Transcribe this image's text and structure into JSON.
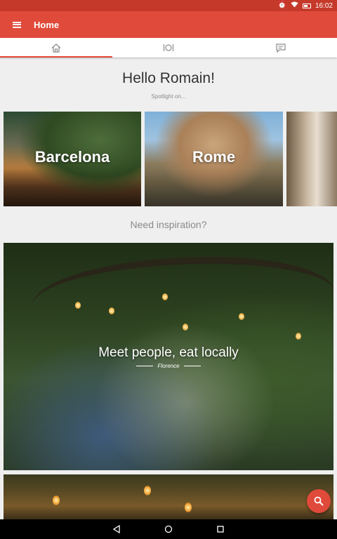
{
  "status_bar": {
    "time": "16:02",
    "icons": [
      "clock-icon",
      "wifi-icon",
      "battery-icon"
    ]
  },
  "app_bar": {
    "title": "Home",
    "background": "#e04a3b"
  },
  "tabs": [
    {
      "name": "home",
      "icon": "home-icon",
      "active": true
    },
    {
      "name": "dining",
      "icon": "plate-cutlery-icon",
      "active": false
    },
    {
      "name": "messages",
      "icon": "message-icon",
      "active": false
    }
  ],
  "greeting": "Hello Romain!",
  "spotlight_label": "Spotlight on...",
  "cities": [
    {
      "label": "Barcelona"
    },
    {
      "label": "Rome"
    },
    {
      "label": ""
    }
  ],
  "inspiration_label": "Need inspiration?",
  "hero": {
    "title": "Meet people, eat locally",
    "subtitle": "Florence"
  },
  "fab": {
    "icon": "search-icon"
  },
  "nav_bar": {
    "icons": [
      "back-icon",
      "home-circle-icon",
      "recents-icon"
    ]
  }
}
